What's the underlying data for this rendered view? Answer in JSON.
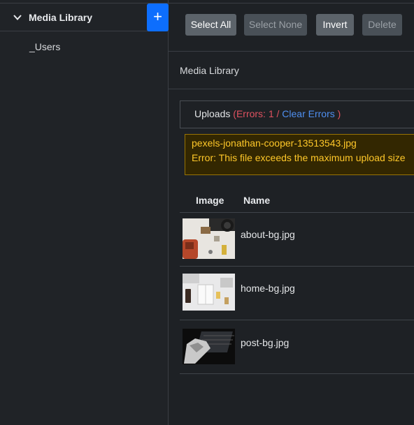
{
  "sidebar": {
    "title": "Media Library",
    "add_label": "+",
    "items": [
      {
        "label": "_Users"
      }
    ]
  },
  "toolbar": {
    "select_all": "Select All",
    "select_none": "Select None",
    "invert": "Invert",
    "delete": "Delete"
  },
  "breadcrumb": "Media Library",
  "uploads": {
    "label": "Uploads",
    "paren_open": "(",
    "errors_text": "Errors: 1",
    "separator": "/",
    "clear_label": "Clear Errors",
    "paren_close": ")"
  },
  "error": {
    "filename": "pexels-jonathan-cooper-13513543.jpg",
    "message": "Error: This file exceeds the maximum upload size"
  },
  "table": {
    "columns": [
      "Image",
      "Name"
    ],
    "rows": [
      {
        "name": "about-bg.jpg"
      },
      {
        "name": "home-bg.jpg"
      },
      {
        "name": "post-bg.jpg"
      }
    ]
  }
}
